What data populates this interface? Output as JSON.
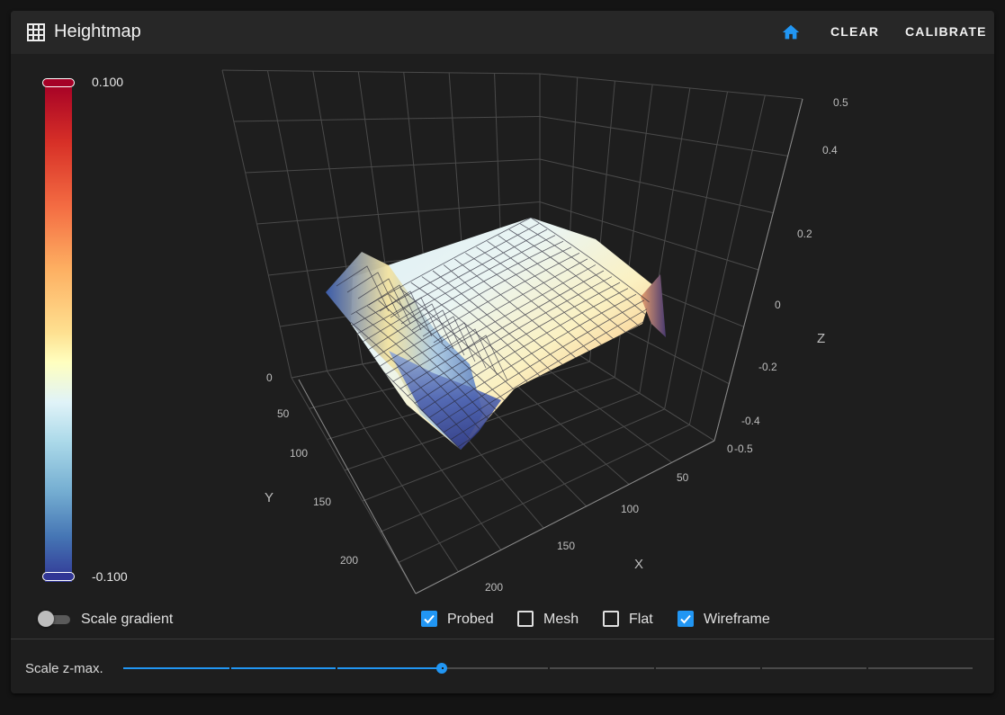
{
  "header": {
    "title": "Heightmap",
    "title_icon": "grid-icon",
    "home_icon": "home-icon",
    "clear_label": "CLEAR",
    "calibrate_label": "CALIBRATE"
  },
  "gradient": {
    "max_label": "0.100",
    "min_label": "-0.100",
    "colors": [
      "#a50026",
      "#d73027",
      "#f46d43",
      "#fdae61",
      "#fee090",
      "#ffffbf",
      "#e0f3f8",
      "#abd9e9",
      "#74add1",
      "#4575b4",
      "#313695"
    ]
  },
  "axes": {
    "x_label": "X",
    "y_label": "Y",
    "z_label": "Z",
    "x_ticks": [
      "0",
      "50",
      "100",
      "150",
      "200"
    ],
    "y_ticks": [
      "0",
      "50",
      "100",
      "150",
      "200"
    ],
    "z_ticks": [
      "-0.5",
      "-0.4",
      "-0.2",
      "0",
      "0.2",
      "0.4",
      "0.5"
    ]
  },
  "options": {
    "scale_gradient_label": "Scale gradient",
    "scale_gradient_on": false,
    "checkboxes": [
      {
        "label": "Probed",
        "checked": true
      },
      {
        "label": "Mesh",
        "checked": false
      },
      {
        "label": "Flat",
        "checked": false
      },
      {
        "label": "Wireframe",
        "checked": true
      }
    ]
  },
  "slider": {
    "label": "Scale z-max.",
    "value_fraction": 0.375,
    "steps": 8
  }
}
